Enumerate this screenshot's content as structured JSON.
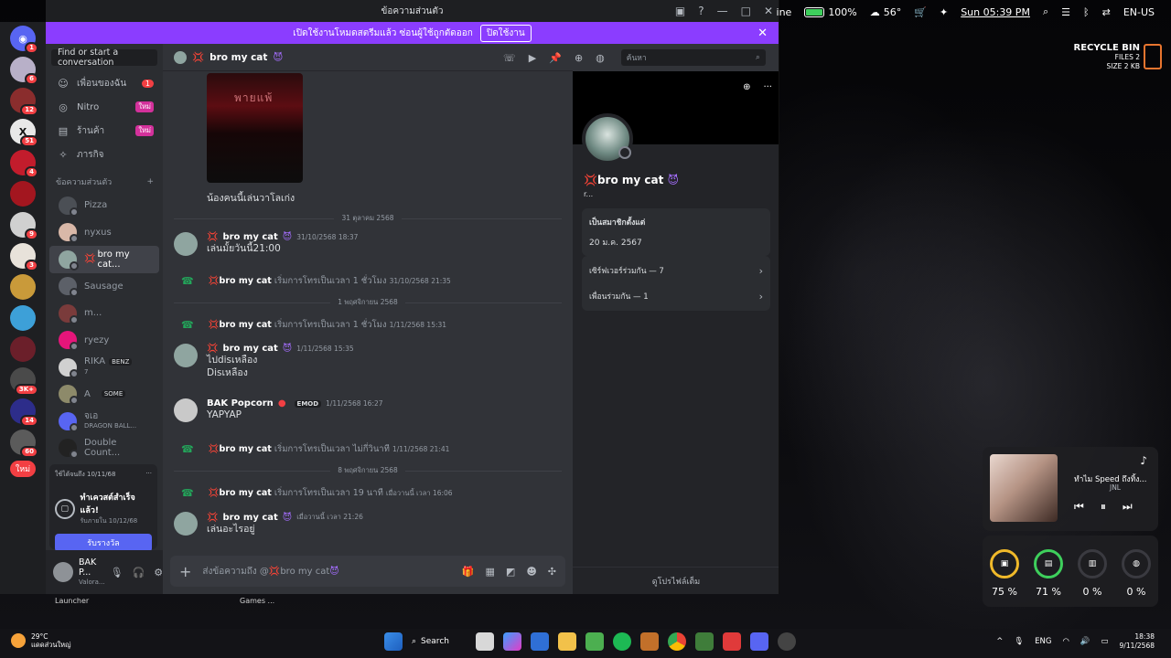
{
  "menubar": {
    "app_name": "ine",
    "battery": "100%",
    "weather": "56°",
    "datetime": "Sun 05:39 PM",
    "lang": "EN-US"
  },
  "window": {
    "title": "ข้อความส่วนตัว",
    "banner_text": "เปิดใช้งานโหมดสตรีมแล้ว ซ่อนผู้ใช้ถูกตัดออก",
    "banner_button": "ปิดใช้งาน"
  },
  "rail": {
    "badges": [
      "1",
      "6",
      "12",
      "51",
      "4",
      "",
      "9",
      "3",
      "",
      "",
      "",
      "3K+",
      "14",
      "60",
      ""
    ],
    "new_label": "ใหม่"
  },
  "sidebar": {
    "search_placeholder": "Find or start a conversation",
    "nav": [
      {
        "label": "เพื่อนของฉัน",
        "badge": "1",
        "pill": ""
      },
      {
        "label": "Nitro",
        "badge": "",
        "pill": "ใหม่"
      },
      {
        "label": "ร้านค้า",
        "badge": "",
        "pill": "ใหม่"
      },
      {
        "label": "ภารกิจ",
        "badge": "",
        "pill": ""
      }
    ],
    "dm_header": "ข้อความส่วนตัว",
    "dms": [
      {
        "name": "Pizza",
        "sub": "",
        "tag": "",
        "color": "#4b4f55"
      },
      {
        "name": "nyxus",
        "sub": "",
        "tag": "",
        "color": "#d9b8a8"
      },
      {
        "name": "bro my cat...",
        "sub": "",
        "tag": "",
        "color": "#8fa5a0"
      },
      {
        "name": "Sausage",
        "sub": "",
        "tag": "",
        "color": "#5c6068"
      },
      {
        "name": "m...",
        "sub": "",
        "tag": "",
        "color": "#7a3b3b"
      },
      {
        "name": "ryezy",
        "sub": "",
        "tag": "",
        "color": "#e6157a"
      },
      {
        "name": "RIKA",
        "sub": "7",
        "tag": "BENZ",
        "color": "#d0d0d0"
      },
      {
        "name": "A",
        "sub": "",
        "tag": "SOME",
        "color": "#8d8a6a"
      },
      {
        "name": "จเอ",
        "sub": "DRAGON BALL...",
        "tag": "",
        "color": "#5865f2"
      },
      {
        "name": "Double Count...",
        "sub": "",
        "tag": "",
        "color": "#222"
      }
    ],
    "quest": {
      "date": "ใช้ได้จนถึง 10/11/68",
      "title": "ทำเควสต์สำเร็จแล้ว!",
      "sub": "รับภายใน 10/12/68",
      "button": "รับรางวัล"
    },
    "user": {
      "name": "BAK P...",
      "status": "Valora..."
    }
  },
  "chat": {
    "header_name": "bro my cat",
    "image_overlay": "พายแพ้",
    "image_caption": "น้องคนนี้เล่นวาโลเก่ง",
    "dividers": [
      "31 ตุลาคม 2568",
      "1 พฤศจิกายน 2568",
      "8 พฤศจิกายน 2568"
    ],
    "messages": [
      {
        "author": "bro my cat",
        "time": "31/10/2568 18:37",
        "lines": [
          "เล่นมั้ยวันนี้21:00"
        ],
        "color": "#8fa5a0"
      },
      {
        "author": "bro my cat",
        "time": "1/11/2568 15:35",
        "lines": [
          "ไปdisเหลือง",
          "Disเหลือง"
        ],
        "color": "#8fa5a0"
      },
      {
        "author": "BAK Popcorn",
        "time": "1/11/2568 16:27",
        "tag": "EMOD",
        "lines": [
          "YAPYAP"
        ],
        "color": "#c9c9c9"
      },
      {
        "author": "bro my cat",
        "time": "เมื่อวานนี้ เวลา 21:26",
        "lines": [
          "เล่นอะไรอยู่"
        ],
        "color": "#8fa5a0"
      }
    ],
    "calls": [
      {
        "who": "bro my cat",
        "text": "เริ่มการโทรเป็นเวลา 1 ชั่วโมง",
        "time": "31/10/2568 21:35"
      },
      {
        "who": "bro my cat",
        "text": "เริ่มการโทรเป็นเวลา 1 ชั่วโมง",
        "time": "1/11/2568 15:31"
      },
      {
        "who": "bro my cat",
        "text": "เริ่มการโทรเป็นเวลา ไม่กี่วินาที",
        "time": "1/11/2568 21:41"
      },
      {
        "who": "bro my cat",
        "text": "เริ่มการโทรเป็นเวลา 19 นาที",
        "time": "เมื่อวานนี้ เวลา 16:06"
      }
    ],
    "composer_placeholder": "ส่งข้อความถึง @",
    "composer_target": "bro my cat",
    "search_placeholder": "ค้นหา"
  },
  "profile": {
    "name": "bro my cat",
    "tag": "r...",
    "member_since_label": "เป็นสมาชิกตั้งแต่",
    "member_since": "20 ม.ค. 2567",
    "mutual_servers": "เซิร์ฟเวอร์ร่วมกัน — 7",
    "mutual_friends": "เพื่อนร่วมกัน — 1",
    "footer": "ดูโปรไฟล์เต็ม"
  },
  "desktop": {
    "recycle_title": "RECYCLE BIN",
    "recycle_files": "FILES 2",
    "recycle_size": "SIZE 2 KB",
    "music_title": "ทำไม Speed ถึงทิ้ง...",
    "music_artist": "JNL",
    "stats": [
      {
        "label": "CPU",
        "value": "75 %"
      },
      {
        "label": "RAM",
        "value": "71 %"
      },
      {
        "label": "DISK",
        "value": "0 %"
      },
      {
        "label": "NET",
        "value": "0 %"
      }
    ],
    "labels": [
      "Launcher",
      "Games ..."
    ]
  },
  "taskbar": {
    "temp": "29°C",
    "weather_desc": "แดดส่วนใหญ่",
    "search": "Search",
    "lang": "ENG",
    "time": "18:38",
    "date": "9/11/2568"
  }
}
